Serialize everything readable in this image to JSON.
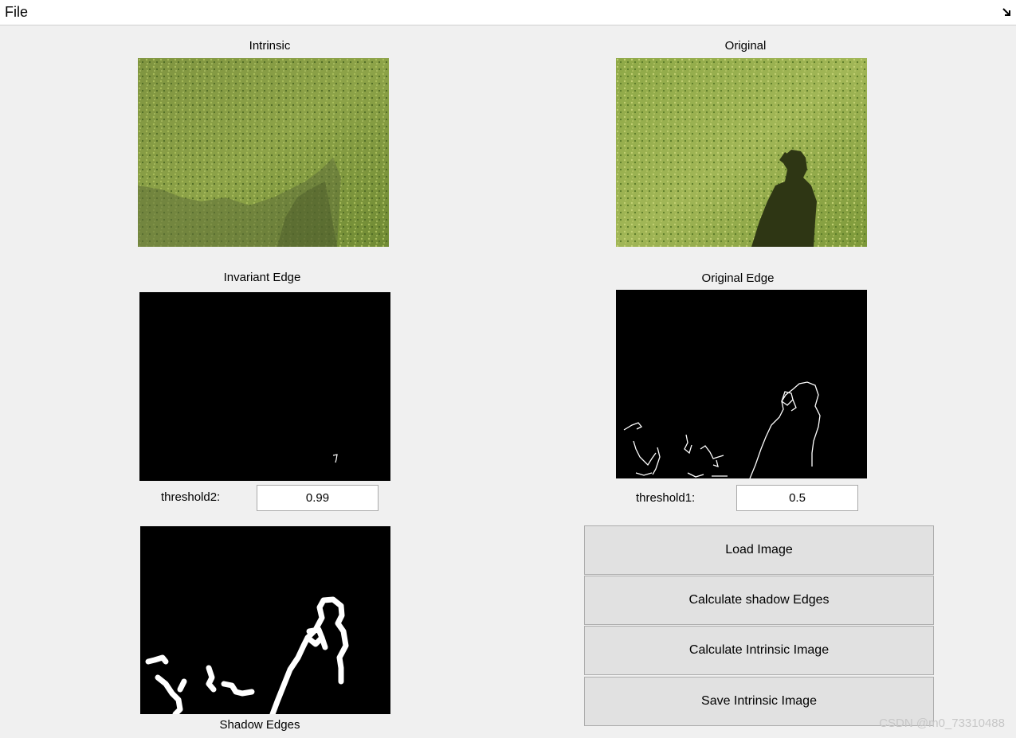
{
  "menu": {
    "file_label": "File",
    "resize_icon": "resize-arrow-icon"
  },
  "axes": {
    "intrinsic_title": "Intrinsic",
    "original_title": "Original",
    "invariant_edge_title": "Invariant Edge",
    "original_edge_title": "Original Edge",
    "shadow_edges_title": "Shadow Edges"
  },
  "params": {
    "threshold2_label": "threshold2:",
    "threshold2_value": "0.99",
    "threshold1_label": "threshold1:",
    "threshold1_value": "0.5"
  },
  "buttons": {
    "load_image": "Load Image",
    "calc_shadow_edges": "Calculate shadow Edges",
    "calc_intrinsic_image": "Calculate Intrinsic Image",
    "save_intrinsic_image": "Save Intrinsic Image"
  },
  "watermark": "CSDN @m0_73310488",
  "colors": {
    "grass_light": "#9db051",
    "grass_dark": "#5f7a2b",
    "shadow": "#2f3513",
    "edge": "#ffffff",
    "plot_bg": "#000000"
  }
}
